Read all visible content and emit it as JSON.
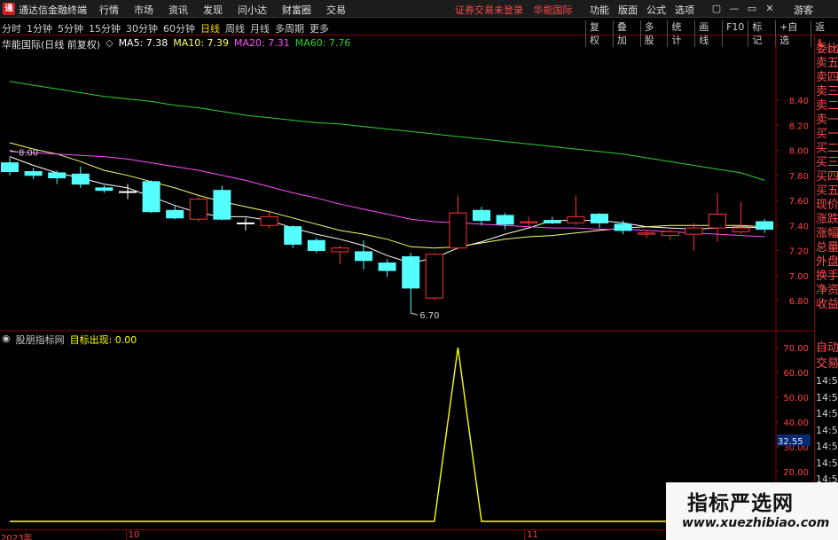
{
  "window": {
    "logo_char": "通",
    "title": "通达信金融终端",
    "menu": [
      "行情",
      "市场",
      "资讯",
      "发现",
      "问小达",
      "财富圈",
      "交易"
    ],
    "notice": [
      "证券交易未登录",
      "华能国际"
    ],
    "right_menu": [
      "功能",
      "版面",
      "公式",
      "选项"
    ],
    "controls": [
      "▢",
      "—",
      "▭",
      "✕"
    ],
    "guest": "游客"
  },
  "periods": {
    "items": [
      "分时",
      "1分钟",
      "5分钟",
      "15分钟",
      "30分钟",
      "60分钟",
      "日线",
      "周线",
      "月线",
      "多周期",
      "更多"
    ],
    "active_index": 6
  },
  "tools": [
    "复权",
    "叠加",
    "多股",
    "统计",
    "画线",
    "F10",
    "标记",
    "+自选",
    "返回"
  ],
  "stock": {
    "label": "华能国际(日线 前复权)",
    "ma5": "MA5: 7.38",
    "ma10": "MA10: 7.39",
    "ma20": "MA20: 7.31",
    "ma60": "MA60: 7.76"
  },
  "indicator": {
    "name": "股朋指标网",
    "series": "目标出现: 0.00",
    "current": "32.55"
  },
  "colors": {
    "up": "#ff3232",
    "down": "#54ffff",
    "ma5": "#ffffff",
    "ma10": "#ffff70",
    "ma20": "#ff50ff",
    "ma60": "#30d030",
    "signal": "#ffff00",
    "axis_red": "#8a0000"
  },
  "chart_data": [
    {
      "type": "candlestick",
      "title": "华能国际(日线 前复权)",
      "y_ticks": [
        "8.40",
        "8.20",
        "8.00",
        "7.80",
        "7.60",
        "7.40",
        "7.20",
        "7.00",
        "6.80"
      ],
      "ylim": [
        6.7,
        8.6
      ],
      "annotations": [
        {
          "text": "8.00",
          "x_index": 0,
          "y": 8.0
        },
        {
          "text": "6.70",
          "x_index": 17,
          "y": 6.7
        }
      ],
      "candles": [
        {
          "o": 7.9,
          "c": 7.83,
          "h": 7.94,
          "l": 7.8
        },
        {
          "o": 7.83,
          "c": 7.8,
          "h": 7.86,
          "l": 7.77
        },
        {
          "o": 7.82,
          "c": 7.78,
          "h": 7.84,
          "l": 7.73
        },
        {
          "o": 7.81,
          "c": 7.73,
          "h": 7.87,
          "l": 7.7
        },
        {
          "o": 7.7,
          "c": 7.68,
          "h": 7.72,
          "l": 7.66
        },
        {
          "o": 7.67,
          "c": 7.67,
          "h": 7.73,
          "l": 7.61
        },
        {
          "o": 7.75,
          "c": 7.51,
          "h": 7.76,
          "l": 7.5
        },
        {
          "o": 7.52,
          "c": 7.46,
          "h": 7.56,
          "l": 7.45
        },
        {
          "o": 7.45,
          "c": 7.61,
          "h": 7.63,
          "l": 7.43
        },
        {
          "o": 7.68,
          "c": 7.45,
          "h": 7.72,
          "l": 7.44
        },
        {
          "o": 7.42,
          "c": 7.42,
          "h": 7.46,
          "l": 7.36
        },
        {
          "o": 7.4,
          "c": 7.47,
          "h": 7.51,
          "l": 7.38
        },
        {
          "o": 7.39,
          "c": 7.25,
          "h": 7.4,
          "l": 7.22
        },
        {
          "o": 7.28,
          "c": 7.2,
          "h": 7.3,
          "l": 7.18
        },
        {
          "o": 7.19,
          "c": 7.22,
          "h": 7.24,
          "l": 7.09
        },
        {
          "o": 7.19,
          "c": 7.12,
          "h": 7.28,
          "l": 7.05
        },
        {
          "o": 7.1,
          "c": 7.04,
          "h": 7.13,
          "l": 6.99
        },
        {
          "o": 7.15,
          "c": 6.9,
          "h": 7.18,
          "l": 6.7
        },
        {
          "o": 6.82,
          "c": 7.17,
          "h": 7.18,
          "l": 6.8
        },
        {
          "o": 7.22,
          "c": 7.5,
          "h": 7.64,
          "l": 7.21
        },
        {
          "o": 7.52,
          "c": 7.44,
          "h": 7.55,
          "l": 7.4
        },
        {
          "o": 7.48,
          "c": 7.41,
          "h": 7.5,
          "l": 7.37
        },
        {
          "o": 7.42,
          "c": 7.43,
          "h": 7.47,
          "l": 7.39
        },
        {
          "o": 7.44,
          "c": 7.42,
          "h": 7.47,
          "l": 7.41
        },
        {
          "o": 7.42,
          "c": 7.47,
          "h": 7.64,
          "l": 7.4
        },
        {
          "o": 7.49,
          "c": 7.42,
          "h": 7.5,
          "l": 7.38
        },
        {
          "o": 7.41,
          "c": 7.36,
          "h": 7.44,
          "l": 7.33
        },
        {
          "o": 7.33,
          "c": 7.34,
          "h": 7.36,
          "l": 7.3
        },
        {
          "o": 7.32,
          "c": 7.35,
          "h": 7.37,
          "l": 7.28
        },
        {
          "o": 7.33,
          "c": 7.38,
          "h": 7.42,
          "l": 7.2
        },
        {
          "o": 7.38,
          "c": 7.49,
          "h": 7.66,
          "l": 7.27
        },
        {
          "o": 7.35,
          "c": 7.38,
          "h": 7.59,
          "l": 7.33
        },
        {
          "o": 7.43,
          "c": 7.37,
          "h": 7.45,
          "l": 7.34
        }
      ],
      "ma_lines": [
        {
          "name": "MA5",
          "values": [
            7.95,
            7.88,
            7.82,
            7.78,
            7.73,
            7.7,
            7.63,
            7.56,
            7.5,
            7.47,
            7.47,
            7.44,
            7.38,
            7.33,
            7.29,
            7.24,
            7.16,
            7.1,
            7.14,
            7.22,
            7.27,
            7.33,
            7.38,
            7.44,
            7.44,
            7.44,
            7.42,
            7.39,
            7.38,
            7.37,
            7.38,
            7.39,
            7.38
          ]
        },
        {
          "name": "MA10",
          "values": [
            8.06,
            8.01,
            7.97,
            7.91,
            7.84,
            7.8,
            7.75,
            7.7,
            7.64,
            7.59,
            7.55,
            7.51,
            7.46,
            7.41,
            7.36,
            7.33,
            7.29,
            7.23,
            7.22,
            7.23,
            7.26,
            7.29,
            7.31,
            7.32,
            7.34,
            7.36,
            7.38,
            7.39,
            7.4,
            7.4,
            7.4,
            7.4,
            7.39
          ]
        },
        {
          "name": "MA20",
          "values": [
            7.99,
            7.98,
            7.97,
            7.96,
            7.95,
            7.93,
            7.9,
            7.87,
            7.84,
            7.8,
            7.76,
            7.71,
            7.66,
            7.62,
            7.57,
            7.53,
            7.49,
            7.45,
            7.43,
            7.42,
            7.41,
            7.4,
            7.39,
            7.38,
            7.38,
            7.37,
            7.37,
            7.36,
            7.35,
            7.34,
            7.33,
            7.32,
            7.31
          ]
        },
        {
          "name": "MA60",
          "values": [
            8.55,
            8.52,
            8.49,
            8.46,
            8.43,
            8.41,
            8.39,
            8.36,
            8.34,
            8.31,
            8.28,
            8.26,
            8.24,
            8.22,
            8.21,
            8.19,
            8.17,
            8.15,
            8.13,
            8.11,
            8.09,
            8.07,
            8.05,
            8.03,
            8.01,
            7.99,
            7.97,
            7.94,
            7.91,
            7.88,
            7.85,
            7.82,
            7.76
          ]
        }
      ]
    },
    {
      "type": "line",
      "title": "股朋指标网",
      "series": [
        {
          "name": "目标出现",
          "values": [
            0,
            0,
            0,
            0,
            0,
            0,
            0,
            0,
            0,
            0,
            0,
            0,
            0,
            0,
            0,
            0,
            0,
            0,
            0,
            70,
            0,
            0,
            0,
            0,
            0,
            0,
            0,
            0,
            0,
            0,
            0,
            0,
            0
          ]
        }
      ],
      "y_ticks": [
        "70.00",
        "60.00",
        "50.00",
        "40.00",
        "30.00",
        "20.00",
        "10.00"
      ],
      "ylim": [
        0,
        80
      ],
      "current_value": "32.55"
    }
  ],
  "x_axis_labels": [
    "2023年",
    "10",
    "11"
  ],
  "side_panel": {
    "top": "L",
    "top_sub": "300",
    "items": [
      "委比",
      "卖五",
      "卖四",
      "卖三",
      "卖二",
      "卖一",
      "买一",
      "买二",
      "买三",
      "买四",
      "买五",
      "现价",
      "涨跌",
      "涨幅",
      "总量",
      "外盘",
      "换手",
      "净资",
      "收益",
      "自动",
      "交易"
    ],
    "times": [
      "14:56",
      "14:56",
      "14:56",
      "14:56",
      "14:56",
      "14:56",
      "14:56",
      "14:56"
    ]
  },
  "watermark": {
    "title": "指标严选网",
    "url": "www.xuezhibiao.com"
  }
}
